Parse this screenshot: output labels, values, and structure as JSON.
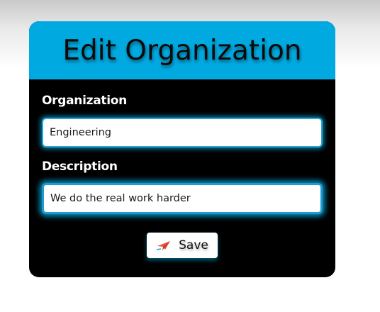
{
  "form": {
    "title": "Edit Organization",
    "organization_label": "Organization",
    "organization_value": "Engineering",
    "description_label": "Description",
    "description_value": "We do the real work harder",
    "save_label": "Save",
    "save_icon": "send-icon"
  },
  "colors": {
    "header_bg": "#00a9e0",
    "card_bg": "#000000",
    "input_glow": "#00a9e0",
    "icon_accent": "#e8563a"
  }
}
